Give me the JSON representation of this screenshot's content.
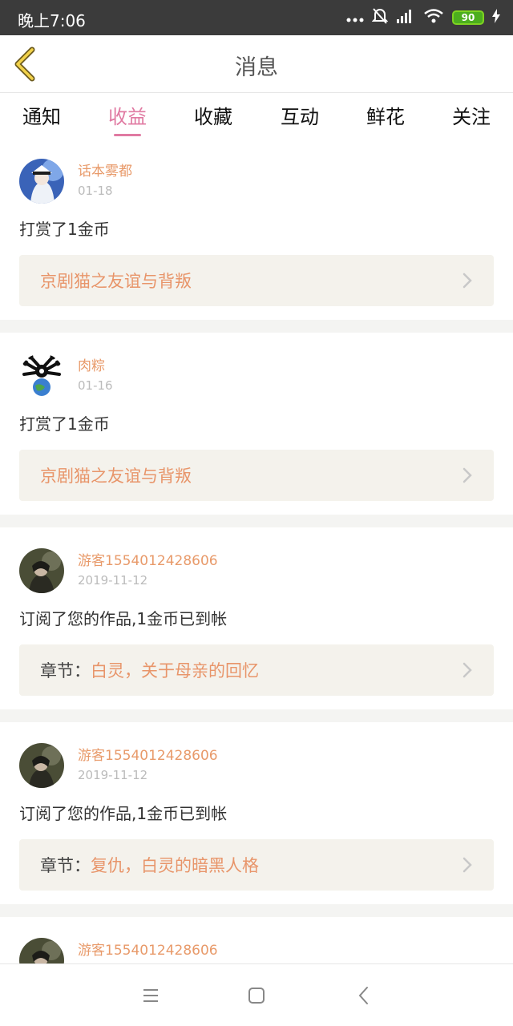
{
  "status": {
    "time": "晚上7:06",
    "battery": "90"
  },
  "header": {
    "title": "消息"
  },
  "tabs": [
    {
      "label": "通知"
    },
    {
      "label": "收益"
    },
    {
      "label": "收藏"
    },
    {
      "label": "互动"
    },
    {
      "label": "鲜花"
    },
    {
      "label": "关注"
    }
  ],
  "active_tab": "收益",
  "feed": [
    {
      "user": "话本雾都",
      "date": "01-18",
      "action": "打赏了1金币",
      "prefix": "",
      "work": "京剧猫之友谊与背叛",
      "avatar": "anime-avatar"
    },
    {
      "user": "肉粽",
      "date": "01-16",
      "action": "打赏了1金币",
      "prefix": "",
      "work": "京剧猫之友谊与背叛",
      "avatar": "globe-avatar"
    },
    {
      "user": "游客1554012428606",
      "date": "2019-11-12",
      "action": "订阅了您的作品,1金币已到帐",
      "prefix": "章节：",
      "work": "白灵，关于母亲的回忆",
      "avatar": "photo-avatar"
    },
    {
      "user": "游客1554012428606",
      "date": "2019-11-12",
      "action": "订阅了您的作品,1金币已到帐",
      "prefix": "章节：",
      "work": "复仇，白灵的暗黑人格",
      "avatar": "photo-avatar"
    },
    {
      "user": "游客1554012428606",
      "date": "2019-11-12",
      "action": "",
      "prefix": "",
      "work": "",
      "avatar": "photo-avatar"
    }
  ],
  "colors": {
    "accent": "#e07aa2",
    "username": "#e89a6a",
    "work_link": "#e8956a",
    "link_bg": "#f4f2ec"
  },
  "icons": {
    "back": "chevron-left-icon",
    "more": "chevron-right-icon",
    "nav": [
      "menu-icon",
      "home-square-icon",
      "back-triangle-icon"
    ]
  }
}
